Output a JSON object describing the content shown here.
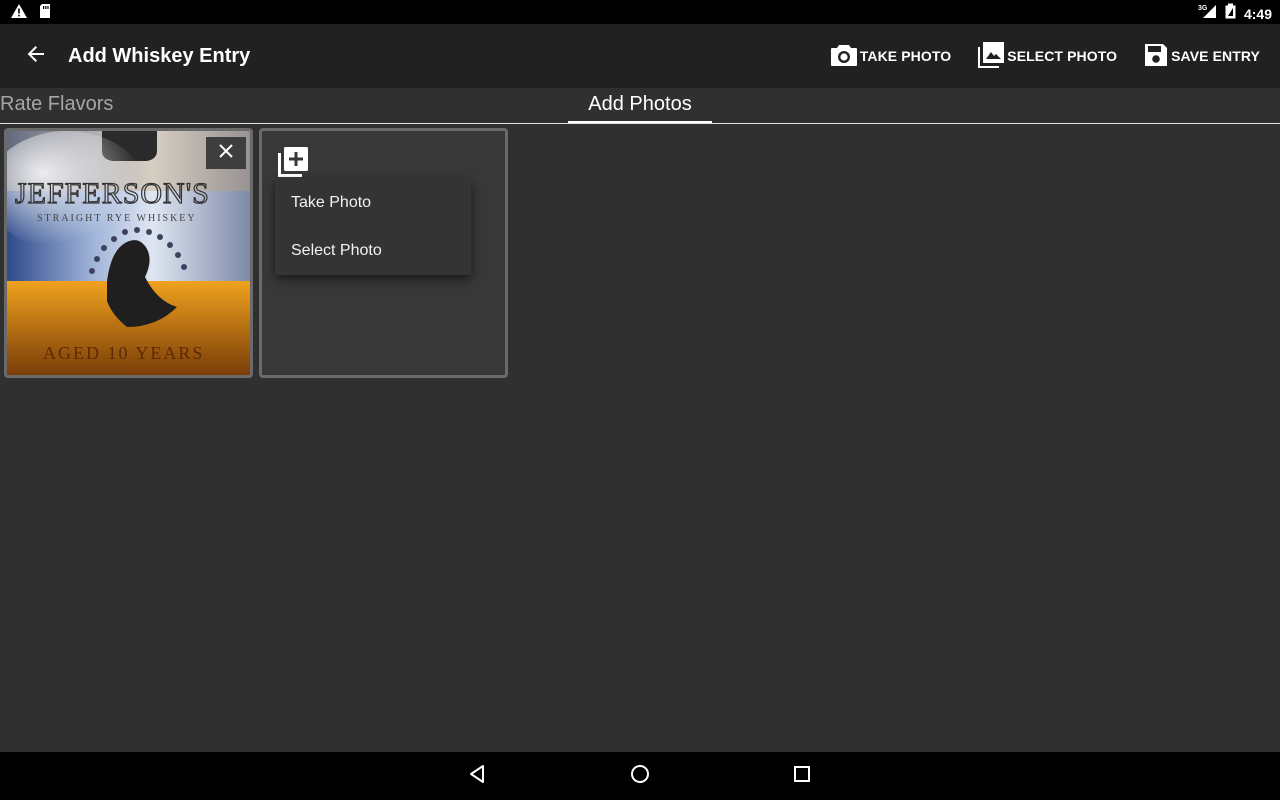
{
  "status_bar": {
    "time": "4:49",
    "network": "3G",
    "icons": [
      "warning-icon",
      "sd-card-icon",
      "signal-icon",
      "battery-icon"
    ]
  },
  "app_bar": {
    "title": "Add Whiskey Entry",
    "back_icon": "arrow-back-icon",
    "actions": {
      "take_photo": "TAKE PHOTO",
      "select_photo": "SELECT PHOTO",
      "save_entry": "SAVE ENTRY"
    }
  },
  "tabs": {
    "rate_flavors": "Rate Flavors",
    "add_photos": "Add Photos",
    "selected": "Add Photos"
  },
  "photo_card": {
    "image": "whiskey-bottle-photo",
    "remove_icon": "close-icon"
  },
  "add_card": {
    "icon": "add-to-photos-icon",
    "menu": {
      "take_photo": "Take Photo",
      "select_photo": "Select Photo"
    }
  },
  "nav_bar": {
    "icons": [
      "back-triangle-icon",
      "home-circle-icon",
      "recents-square-icon"
    ]
  },
  "colors": {
    "background": "#303030",
    "app_bar": "#212121",
    "status_bar": "#000000",
    "card_border": "#6a6a6a",
    "menu": "#343434"
  }
}
